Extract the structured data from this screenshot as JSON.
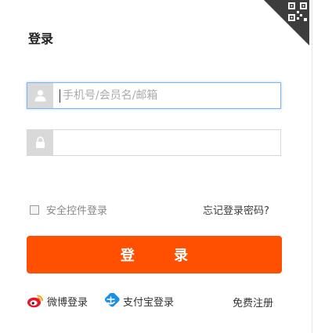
{
  "login": {
    "title": "登录",
    "username": {
      "placeholder": "手机号/会员名/邮箱",
      "value": "",
      "icon": "user-icon"
    },
    "password": {
      "placeholder": "",
      "value": "",
      "icon": "lock-icon"
    },
    "safe_control": {
      "label": "安全控件登录",
      "checked": false
    },
    "forgot_password": "忘记登录密码?",
    "submit_label": "登 录",
    "footer": {
      "weibo_label": "微博登录",
      "alipay_label": "支付宝登录",
      "register_label": "免费注册"
    },
    "qr_corner_icon": "qr-code-icon"
  },
  "colors": {
    "accent": "#ff4f00",
    "focus_border": "#7eb6e6",
    "icon_bg": "#d9d9d9"
  }
}
